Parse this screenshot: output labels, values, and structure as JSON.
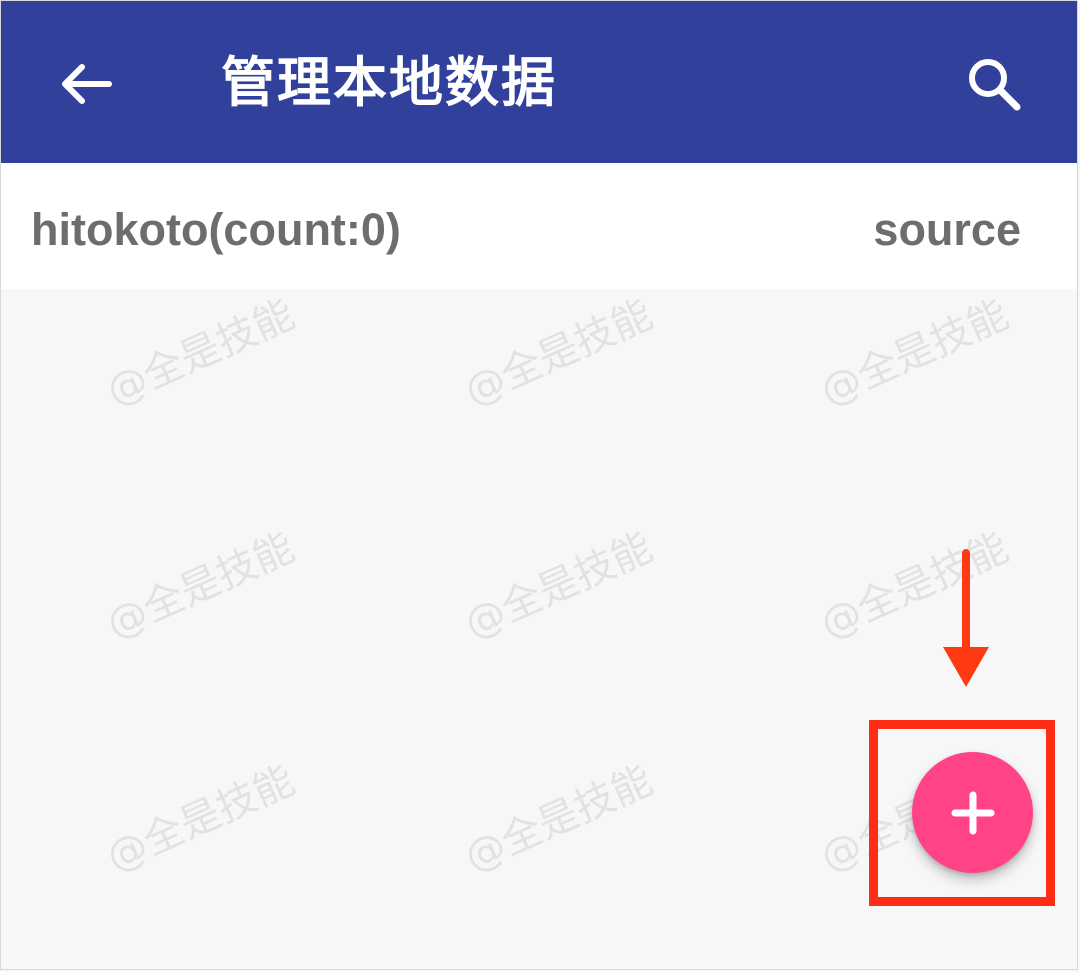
{
  "app": {
    "title": "管理本地数据"
  },
  "toolbar": {
    "back_icon": "arrow-left-icon",
    "search_icon": "search-icon"
  },
  "list_header": {
    "left_text": "hitokoto(count:0)",
    "right_text": "source"
  },
  "watermark": {
    "text": "@全是技能"
  },
  "fab": {
    "icon": "plus-icon"
  },
  "colors": {
    "appbar": "#31409b",
    "background": "#f7f7f7",
    "row_background": "#ffffff",
    "row_text": "#6d6d6d",
    "fab": "#ff4386",
    "annotation": "#ff2d15",
    "watermark": "#b5b5b5"
  }
}
